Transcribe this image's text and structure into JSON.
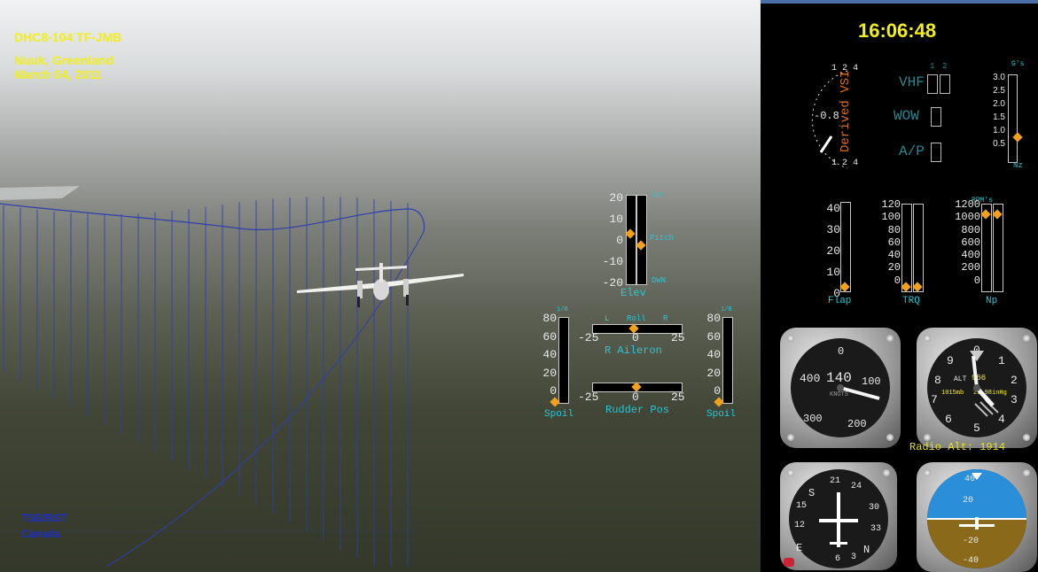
{
  "header": {
    "aircraft": "DHC8-104 TF-JMB",
    "location": "Nuuk, Greenland",
    "date": "March 04, 2011",
    "clock": "16:06:48"
  },
  "footer": {
    "org": "TSB/BST",
    "country": "Canada"
  },
  "elevator": {
    "ticks": [
      "20",
      "10",
      "0",
      "-10",
      "-20"
    ],
    "up": "Up",
    "pitch": "Pitch",
    "dwn": "DWN",
    "label": "Elev",
    "elev_value": 0.5,
    "pitch_value": 0.43
  },
  "aileron": {
    "ticks": [
      "-25",
      "0",
      "25"
    ],
    "left": "L",
    "roll": "Roll",
    "right": "R",
    "label": "R Aileron",
    "value": 0.0
  },
  "rudder": {
    "ticks": [
      "-25",
      "0",
      "25"
    ],
    "label": "Rudder Pos",
    "value": 0.0
  },
  "spoiler_left": {
    "ticks": [
      "80",
      "60",
      "40",
      "20",
      "0"
    ],
    "unit": "1/B",
    "label": "Spoil",
    "value": 0.0
  },
  "spoiler_right": {
    "ticks": [
      "80",
      "60",
      "40",
      "20",
      "0"
    ],
    "unit": "1/B",
    "label": "Spoil",
    "value": 0.0
  },
  "vsi": {
    "label": "Derived VSI",
    "value": "-0.8",
    "scale_top": [
      "1",
      "2",
      "4"
    ],
    "scale_bottom": [
      "1",
      "2",
      "4"
    ]
  },
  "indicators": {
    "vhf": "VHF",
    "vhf_nums": [
      "1",
      "2"
    ],
    "wow": "WOW",
    "ap": "A/P"
  },
  "gforce": {
    "unit": "G's",
    "ticks": [
      "3.0",
      "2.5",
      "2.0",
      "1.5",
      "1.0",
      "0.5"
    ],
    "label": "Nz",
    "value": 1.0
  },
  "flap": {
    "ticks": [
      "40",
      "30",
      "20",
      "10",
      "0"
    ],
    "label": "Flap",
    "value": 0.0
  },
  "trq": {
    "ticks": [
      "120",
      "100",
      "80",
      "60",
      "40",
      "20",
      "0"
    ],
    "label": "TRQ",
    "values": [
      0.0,
      0.0
    ]
  },
  "np": {
    "unit": "RPM's",
    "ticks": [
      "1200",
      "1000",
      "800",
      "600",
      "400",
      "200",
      "0"
    ],
    "label": "Np",
    "values": [
      1000,
      1000
    ]
  },
  "airspeed": {
    "labels": [
      "0",
      "400",
      "140",
      "100",
      "KNOTS",
      "300",
      "200"
    ]
  },
  "altimeter": {
    "labels": [
      "0",
      "1",
      "9",
      "2",
      "8",
      "ALT",
      "966",
      "7",
      "3",
      "6",
      "5",
      "4",
      "1015mb",
      "29.98inHg"
    ]
  },
  "radio_alt": {
    "label": "Radio Alt:",
    "value": "1914"
  },
  "heading": {
    "labels": [
      "21",
      "24",
      "S",
      "30",
      "33",
      "N",
      "E",
      "12",
      "15",
      "6",
      "3"
    ]
  },
  "attitude": {
    "labels": [
      "40",
      "20",
      "-20",
      "-40"
    ]
  },
  "colors": {
    "accent_yellow": "#f2ee1a",
    "cyan": "#25c7d8",
    "orange": "#f2a21a",
    "vsi_orange": "#d8701e"
  }
}
